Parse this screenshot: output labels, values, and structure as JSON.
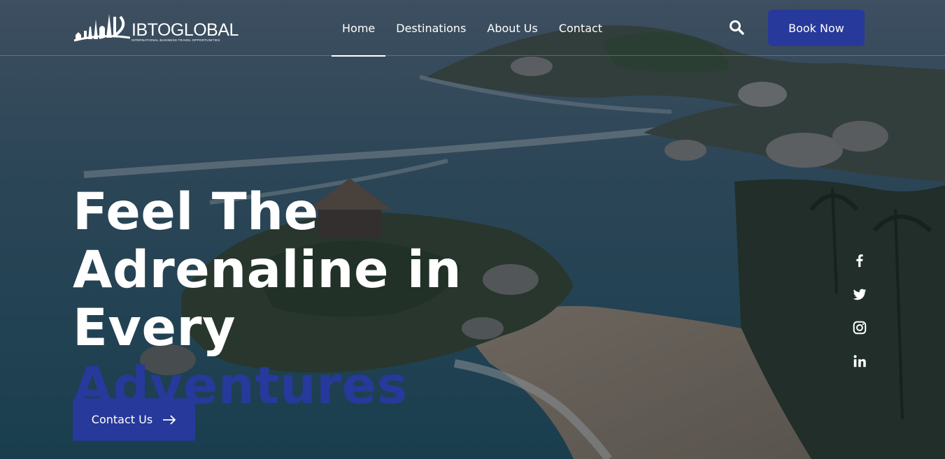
{
  "brand": {
    "name": "IBTOGLOBAL",
    "tagline": "INTERNATIONAL BUSINESS TRAVEL OPPORTUNITIES"
  },
  "nav": {
    "items": [
      {
        "label": "Home",
        "active": true
      },
      {
        "label": "Destinations",
        "active": false
      },
      {
        "label": "About Us",
        "active": false
      },
      {
        "label": "Contact",
        "active": false
      }
    ]
  },
  "header": {
    "search_icon": "search-icon",
    "book_label": "Book Now"
  },
  "hero": {
    "line1": "Feel The",
    "line2": "Adrenaline in",
    "line3_plain": "Every",
    "line3_accent": "Adventures",
    "cta_label": "Contact Us",
    "cta_icon": "arrow-right-icon"
  },
  "social": [
    "facebook-icon",
    "twitter-icon",
    "instagram-icon",
    "linkedin-icon"
  ],
  "colors": {
    "accent": "#27399a",
    "text": "#ffffff"
  }
}
